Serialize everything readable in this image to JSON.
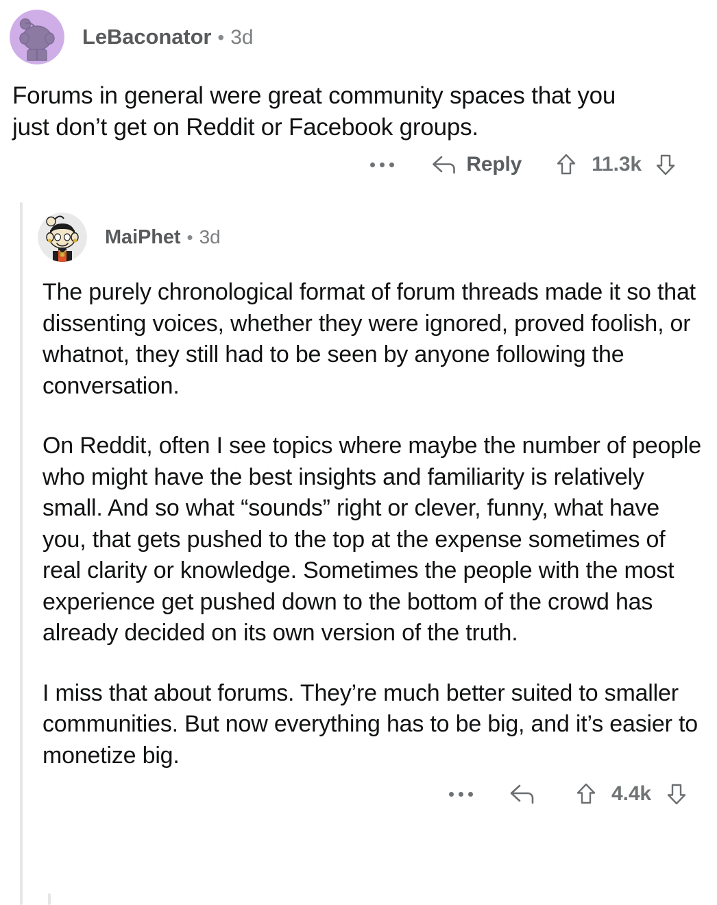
{
  "thread": {
    "comments": [
      {
        "id": "comment-top",
        "author": "LeBaconator",
        "separator": "•",
        "timestamp": "3d",
        "avatar_kind": "snoo-purple",
        "paragraphs": [
          "Forums in general were great community spaces that you just don’t get on Reddit or Facebook groups."
        ],
        "actions": {
          "overflow_icon": "kebab-icon",
          "reply_icon": "reply-arrow-icon",
          "reply_label": "Reply",
          "upvote_icon": "upvote-arrow-icon",
          "score": "11.3k",
          "downvote_icon": "downvote-arrow-icon"
        }
      },
      {
        "id": "comment-nested",
        "author": "MaiPhet",
        "separator": "•",
        "timestamp": "3d",
        "avatar_kind": "snoo-custom-black-hair",
        "paragraphs": [
          "The purely chronological format of forum threads made it so that dissenting voices, whether they were ignored, proved foolish, or whatnot, they still had to be seen by anyone following the conversation.",
          "On Reddit, often I see topics where maybe the number of people who might have the best insights and familiarity is relatively small. And so what “sounds” right or clever, funny, what have you, that gets pushed to the top at the expense sometimes of real clarity or knowledge. Sometimes the people with the most experience get pushed down to the bottom of the crowd has already decided on its own version of the truth.",
          "I miss that about forums. They’re much better suited to smaller communities. But now everything has to be big, and it’s easier to monetize big."
        ],
        "actions": {
          "overflow_icon": "kebab-icon",
          "reply_icon": "reply-arrow-icon",
          "upvote_icon": "upvote-arrow-icon",
          "score": "4.4k",
          "downvote_icon": "downvote-arrow-icon"
        }
      }
    ]
  },
  "colors": {
    "page_background": "#ffffff",
    "body_text": "#111213",
    "meta_text": "#585a5c",
    "muted_text": "#7c7f81",
    "icon_stroke": "#6b6e70",
    "thread_line": "#e6e6e6",
    "avatar_purple_bg": "#cfaee8",
    "avatar_purple_snoo": "#8c7aa3",
    "avatar_gray_bg": "#e9e9ea",
    "avatar_skin": "#f2e6c8",
    "avatar_hair": "#1c1c1c",
    "avatar_jacket": "#1f1f1f",
    "avatar_shirt": "#e0522c",
    "avatar_gold": "#d9b23c"
  }
}
